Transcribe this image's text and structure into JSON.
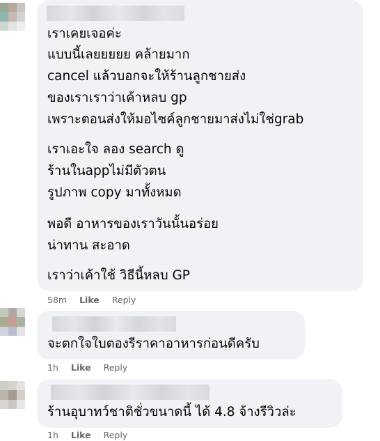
{
  "comments": [
    {
      "paragraphs": [
        [
          "เราเคยเจอค่ะ",
          "แบบนี้เลยยยยย คล้ายมาก",
          "cancel แล้วบอกจะให้ร้านลูกชายส่ง",
          "ของเราเราว่าเค้าหลบ gp",
          "เพราะตอนส่งให้มอไซค์ลูกชายมาส่งไม่ใช่grab"
        ],
        [
          "เราเอะใจ ลอง search ดู",
          "ร้านในappไม่มีตัวตน",
          "รูปภาพ copy มาทั้งหมด"
        ],
        [
          "พอดี อาหารของเราวันนั้นอร่อย",
          "น่าทาน สะอาด"
        ],
        [
          "เราว่าเค้าใช้ วิธีนี้หลบ GP"
        ]
      ],
      "time": "58m",
      "like_label": "Like",
      "reply_label": "Reply"
    },
    {
      "paragraphs": [
        [
          "จะตกใจใบตองรีราคาอาหารก่อนดีครับ"
        ]
      ],
      "time": "1h",
      "like_label": "Like",
      "reply_label": "Reply"
    },
    {
      "paragraphs": [
        [
          "ร้านอุบาทว์ชาติชั่วขนาดนี้ ได้ 4.8 จ้างรีวิวล่ะ"
        ]
      ],
      "time": "1h",
      "like_label": "Like",
      "reply_label": "Reply"
    }
  ]
}
